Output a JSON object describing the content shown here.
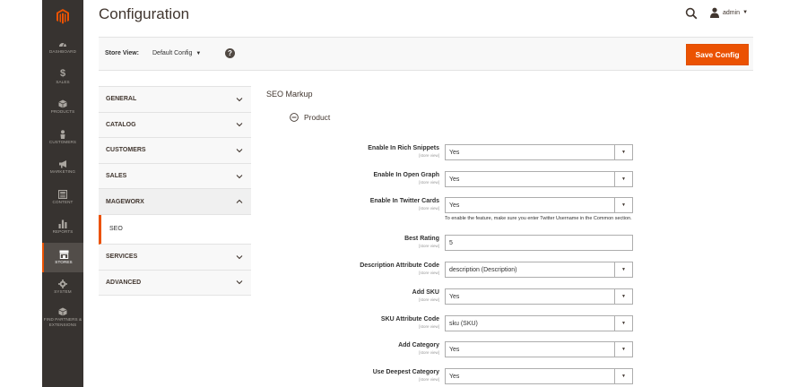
{
  "brand_color": "#eb5202",
  "sidebar": {
    "items": [
      {
        "label": "DASHBOARD",
        "icon": "dashboard-icon"
      },
      {
        "label": "SALES",
        "icon": "dollar-icon"
      },
      {
        "label": "PRODUCTS",
        "icon": "cube-icon"
      },
      {
        "label": "CUSTOMERS",
        "icon": "person-icon"
      },
      {
        "label": "MARKETING",
        "icon": "megaphone-icon"
      },
      {
        "label": "CONTENT",
        "icon": "content-icon"
      },
      {
        "label": "REPORTS",
        "icon": "bar-chart-icon"
      },
      {
        "label": "STORES",
        "icon": "store-icon"
      },
      {
        "label": "SYSTEM",
        "icon": "gear-icon"
      },
      {
        "label": "FIND PARTNERS & EXTENSIONS",
        "icon": "partners-icon"
      }
    ]
  },
  "header": {
    "title": "Configuration",
    "user": "admin"
  },
  "toolbar": {
    "store_view_label": "Store View:",
    "store_view_value": "Default Config",
    "save_label": "Save Config"
  },
  "tabs": [
    {
      "label": "GENERAL",
      "state": "collapsed"
    },
    {
      "label": "CATALOG",
      "state": "collapsed"
    },
    {
      "label": "CUSTOMERS",
      "state": "collapsed"
    },
    {
      "label": "SALES",
      "state": "collapsed"
    },
    {
      "label": "MAGEWORX",
      "state": "expanded",
      "children": [
        {
          "label": "SEO"
        }
      ]
    },
    {
      "label": "SERVICES",
      "state": "collapsed"
    },
    {
      "label": "ADVANCED",
      "state": "collapsed"
    }
  ],
  "section": {
    "title": "SEO Markup",
    "group_label": "Product"
  },
  "fields": [
    {
      "label": "Enable In Rich Snippets",
      "scope": "[store view]",
      "value": "Yes",
      "type": "select"
    },
    {
      "label": "Enable In Open Graph",
      "scope": "[store view]",
      "value": "Yes",
      "type": "select"
    },
    {
      "label": "Enable In Twitter Cards",
      "scope": "[store view]",
      "value": "Yes",
      "type": "select",
      "note": "To enable the feature, make sure you enter Twitter Username in the Common section."
    },
    {
      "label": "Best Rating",
      "scope": "[store view]",
      "value": "5",
      "type": "text"
    },
    {
      "label": "Description Attribute Code",
      "scope": "[store view]",
      "value": "description (Description)",
      "type": "select"
    },
    {
      "label": "Add SKU",
      "scope": "[store view]",
      "value": "Yes",
      "type": "select"
    },
    {
      "label": "SKU Attribute Code",
      "scope": "[store view]",
      "value": "sku (SKU)",
      "type": "select"
    },
    {
      "label": "Add Category",
      "scope": "[store view]",
      "value": "Yes",
      "type": "select"
    },
    {
      "label": "Use Deepest Category",
      "scope": "[store view]",
      "value": "Yes",
      "type": "select"
    }
  ]
}
